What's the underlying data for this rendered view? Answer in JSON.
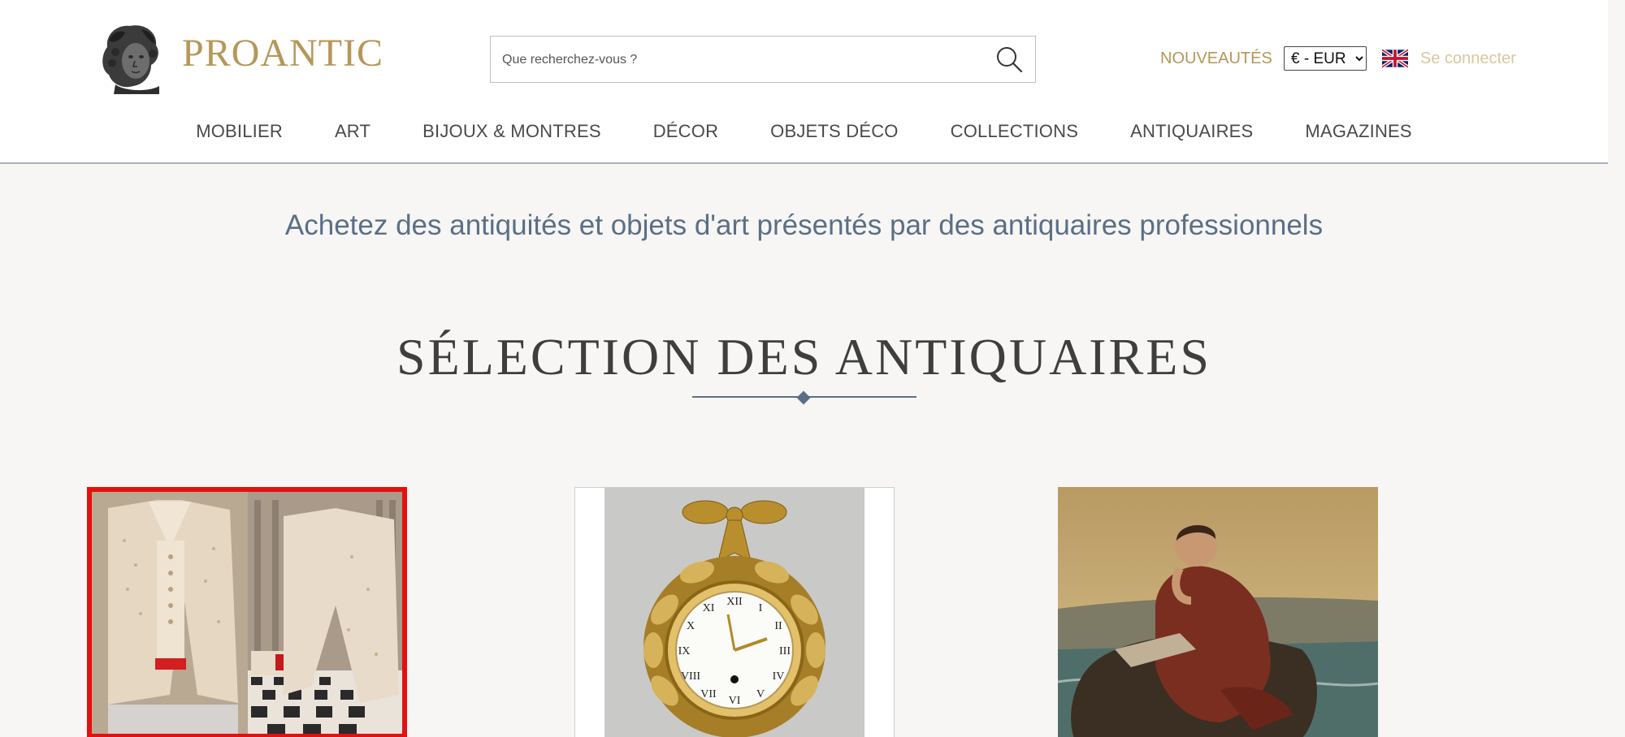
{
  "header": {
    "brand": "PROANTIC",
    "search": {
      "placeholder": "Que recherchez-vous ?"
    },
    "new_link": "NOUVEAUTÉS",
    "currency": {
      "selected": "€ - EUR"
    },
    "language_icon": "uk-flag-icon",
    "login": "Se connecter"
  },
  "nav": [
    "MOBILIER",
    "ART",
    "BIJOUX & MONTRES",
    "DÉCOR",
    "OBJETS DÉCO",
    "COLLECTIONS",
    "ANTIQUAIRES",
    "MAGAZINES"
  ],
  "main": {
    "tagline": "Achetez des antiquités et objets d'art présentés par des antiquaires professionnels",
    "section_title": "SÉLECTION DES ANTIQUAIRES"
  },
  "cards": [
    {
      "image": "embroidered-18th-century-coats"
    },
    {
      "image": "gilt-bronze-wall-clock"
    },
    {
      "image": "romantic-painting-seated-man-by-sea"
    }
  ],
  "colors": {
    "brand_gold": "#b59758",
    "nav_text": "#4a4a4a",
    "tagline_blue": "#5a6f87",
    "highlight_red": "#e41010",
    "background": "#f7f6f4"
  }
}
